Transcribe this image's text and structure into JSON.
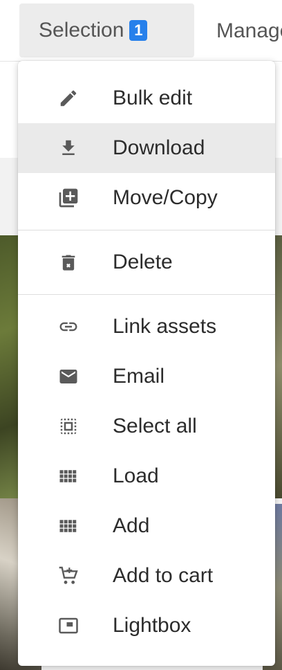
{
  "toolbar": {
    "selection_label": "Selection",
    "selection_count": "1",
    "manage_label": "Manage"
  },
  "menu": {
    "items": [
      {
        "label": "Bulk edit",
        "icon": "pencil-icon"
      },
      {
        "label": "Download",
        "icon": "download-icon"
      },
      {
        "label": "Move/Copy",
        "icon": "move-copy-icon"
      },
      {
        "label": "Delete",
        "icon": "trash-icon"
      },
      {
        "label": "Link assets",
        "icon": "link-icon"
      },
      {
        "label": "Email",
        "icon": "envelope-icon"
      },
      {
        "label": "Select all",
        "icon": "select-all-icon"
      },
      {
        "label": "Load",
        "icon": "grid-icon"
      },
      {
        "label": "Add",
        "icon": "grid-icon"
      },
      {
        "label": "Add to cart",
        "icon": "cart-add-icon"
      },
      {
        "label": "Lightbox",
        "icon": "lightbox-icon"
      }
    ]
  },
  "colors": {
    "accent": "#2680eb",
    "icon": "#5a5a5a",
    "highlight": "#eaeaea"
  }
}
